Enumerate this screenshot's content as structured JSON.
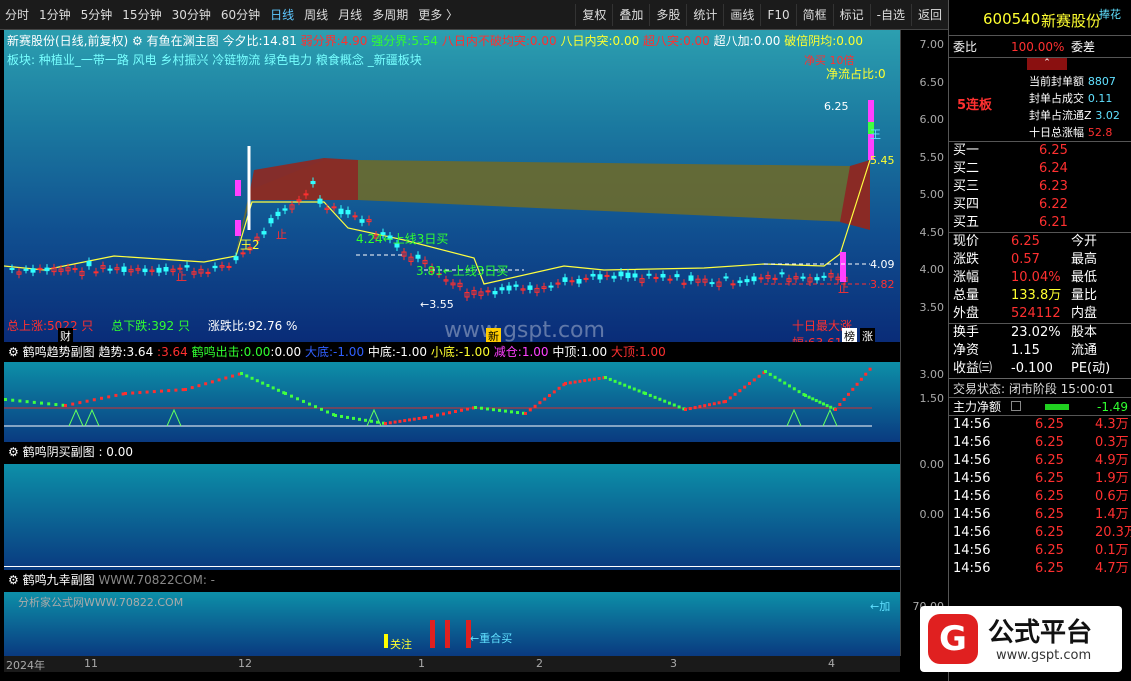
{
  "toolbar": {
    "timeframes": [
      "分时",
      "1分钟",
      "5分钟",
      "15分钟",
      "30分钟",
      "60分钟",
      "日线",
      "周线",
      "月线",
      "多周期",
      "更多 〉"
    ],
    "active": "日线",
    "buttons": [
      "复权",
      "叠加",
      "多股",
      "统计",
      "画线",
      "F10",
      "简框",
      "标记",
      "-自选",
      "返回"
    ]
  },
  "main": {
    "name": "新赛股份(日线,前复权)",
    "indicator": "有鱼在渊主图",
    "jinxi_label": "今夕比:",
    "jinxi": "14.81",
    "rfj_label": "弱分界:",
    "rfj": "4.90",
    "qfj_label": "强分界:",
    "qfj": "5.54",
    "bdn_label": "八日内不破均突:",
    "bdn": "0.00",
    "brt_label": "八日内突:",
    "brt": "0.00",
    "cbt_label": "超八突:",
    "cbt": "0.00",
    "cbj_label": "超八加:",
    "cbj": "0.00",
    "pbyj_label": "破倍阴均:",
    "pbyj": "0.00",
    "sectors": "板块:   种植业_一带一路 风电 乡村振兴 冷链物流 绿色电力 粮食概念 _新疆板块",
    "zdz_label": "总上涨:",
    "zdz": "5022 只",
    "zdx_label": "总下跌:",
    "zdx": "392 只",
    "zdb_label": "涨跌比:",
    "zdb": "92.76 %",
    "max_label": "十日最大涨幅:63.61",
    "jlz_label": "净流占比:0",
    "top_tag": "净买  10倍",
    "annot": {
      "wang2": "王2",
      "up1": "4.24←上线3日买",
      "up2": "3.81←上线3日买",
      "low": "←3.55",
      "p625": "6.25",
      "p545": "5.45",
      "p409": "4.09",
      "p382": "3.82",
      "wang": "王",
      "cai": "财",
      "xin": "新",
      "bang": "榜",
      "zhang": "涨",
      "zhi": "止",
      "watermark": "www.gspt.com"
    },
    "yaxis": [
      "7.00",
      "6.50",
      "6.00",
      "5.50",
      "5.00",
      "4.50",
      "4.00",
      "3.50"
    ]
  },
  "sub1": {
    "title": "鹤鸣趋势副图",
    "trend_label": "趋势:",
    "t1": "3.64",
    "t2": "3.64",
    "hmcj_label": "鹤鸣出击:",
    "hmcj": "0.00",
    "hmcj2": "0.00",
    "dd_label": "大底:",
    "dd": "-1.00",
    "zd_label": "中底:",
    "zd": "-1.00",
    "xd_label": "小底:",
    "xd": "-1.00",
    "jh_label": "减仓:",
    "jh": "1.00",
    "zdg_label": "中顶:",
    "zdg": "1.00",
    "ddg_label": "大顶:",
    "ddg": "1.00",
    "yaxis": [
      "3.00",
      "1.50"
    ]
  },
  "sub2": {
    "title": "鹤鸣阴买副图",
    "value": ": 0.00",
    "yaxis": [
      "0.00",
      "0.00"
    ]
  },
  "sub3": {
    "title": "鹤鸣九幸副图",
    "sub": "WWW.70822COM: -",
    "wm": "分析家公式网WWW.70822.COM",
    "focus": "关注",
    "combo": "←重合买",
    "jia": "←加",
    "yaxis": [
      "70.00",
      "3"
    ]
  },
  "xaxis": [
    "2024年",
    "11",
    "12",
    "1",
    "2",
    "3",
    "4"
  ],
  "right": {
    "code": "600540",
    "stock": "新赛股份",
    "huaqi": "捧花",
    "weibi_label": "委比",
    "weibi": "100.00%",
    "weicha_label": "委差",
    "lianban": "5连板",
    "feng": [
      {
        "l": "当前封单额",
        "v": "8807"
      },
      {
        "l": "封单占成交",
        "v": "0.11"
      },
      {
        "l": "封单占流通Z",
        "v": "3.02"
      },
      {
        "l": "十日总涨幅",
        "v": "52.8"
      }
    ],
    "buy": [
      {
        "l": "买一",
        "p": "6.25"
      },
      {
        "l": "买二",
        "p": "6.24"
      },
      {
        "l": "买三",
        "p": "6.23"
      },
      {
        "l": "买四",
        "p": "6.22"
      },
      {
        "l": "买五",
        "p": "6.21"
      }
    ],
    "quote": [
      {
        "l1": "现价",
        "v1": "6.25",
        "l2": "今开",
        "c": "red"
      },
      {
        "l1": "涨跌",
        "v1": "0.57",
        "l2": "最高",
        "c": "red"
      },
      {
        "l1": "涨幅",
        "v1": "10.04%",
        "l2": "最低",
        "c": "red"
      },
      {
        "l1": "总量",
        "v1": "133.8万",
        "l2": "量比",
        "c": "yel"
      },
      {
        "l1": "外盘",
        "v1": "524112",
        "l2": "内盘",
        "c": "red"
      }
    ],
    "stats": [
      {
        "l1": "换手",
        "v1": "23.02%",
        "l2": "股本"
      },
      {
        "l1": "净资",
        "v1": "1.15",
        "l2": "流通"
      },
      {
        "l1": "收益㈢",
        "v1": "-0.100",
        "l2": "PE(动)"
      }
    ],
    "status": "交易状态: 闭市阶段 15:00:01",
    "flow_label": "主力净额",
    "flow": "-1.49",
    "ticks": [
      [
        "14:56",
        "6.25",
        "4.3万"
      ],
      [
        "14:56",
        "6.25",
        "0.3万"
      ],
      [
        "14:56",
        "6.25",
        "4.9万"
      ],
      [
        "14:56",
        "6.25",
        "1.9万"
      ],
      [
        "14:56",
        "6.25",
        "0.6万"
      ],
      [
        "14:56",
        "6.25",
        "1.4万"
      ],
      [
        "14:56",
        "6.25",
        "20.3万"
      ],
      [
        "14:56",
        "6.25",
        "0.1万"
      ],
      [
        "14:56",
        "6.25",
        "4.7万"
      ]
    ]
  },
  "logo": {
    "cn": "公式平台",
    "en": "www.gspt.com"
  },
  "colors": {
    "up": "#ff3030",
    "down": "#30ffff",
    "band_green": "#6b6a2c",
    "band_red": "#8a2a25",
    "bg_top": "#2c9fb0",
    "bg_bot": "#0a2c78"
  }
}
